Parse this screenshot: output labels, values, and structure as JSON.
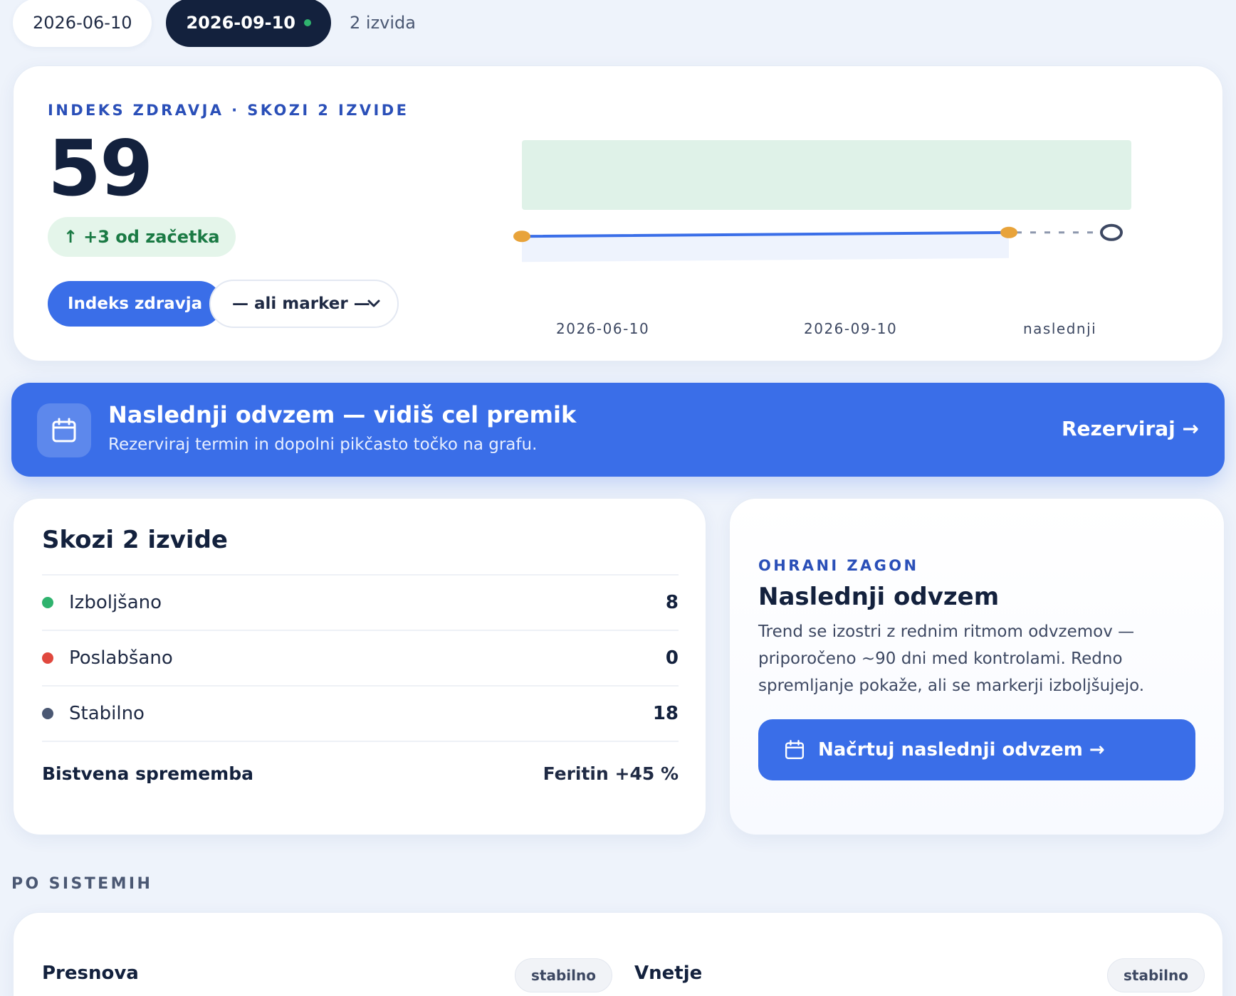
{
  "visits": {
    "tabs": [
      {
        "date": "2026-06-10",
        "active": false
      },
      {
        "date": "2026-09-10",
        "active": true
      }
    ],
    "count_label": "2 izvida"
  },
  "health_index": {
    "eyebrow": "INDEKS ZDRAVJA · SKOZI 2 IZVIDE",
    "score": "59",
    "delta_arrow": "↑",
    "delta_label": "+3 od začetka",
    "metric_button": "Indeks zdravja",
    "marker_select": {
      "selected": "— ali marker —"
    }
  },
  "chart_data": {
    "type": "line",
    "x": [
      "2026-06-10",
      "2026-09-10",
      "naslednji"
    ],
    "series": [
      {
        "values": [
          56,
          59,
          null
        ]
      }
    ],
    "projection": {
      "from": "2026-09-10",
      "to": "naslednji",
      "style": "dotted",
      "open_point": true
    },
    "target_band": true,
    "colors": {
      "line": "#3a6ee8",
      "point": "#e8a33a",
      "band": "#dcf1e6",
      "open_point": "#3d4862"
    }
  },
  "banner": {
    "title": "Naslednji odvzem — vidiš cel premik",
    "subtitle": "Rezerviraj termin in dopolni pikčasto točko na grafu.",
    "cta": "Rezerviraj →",
    "icon": "calendar-icon"
  },
  "summary": {
    "title": "Skozi 2 izvide",
    "rows": [
      {
        "label": "Izboljšano",
        "value": "8",
        "color": "#2fb36e"
      },
      {
        "label": "Poslabšano",
        "value": "0",
        "color": "#e0483e"
      },
      {
        "label": "Stabilno",
        "value": "18",
        "color": "#4b5873"
      }
    ],
    "footer": {
      "label": "Bistvena sprememba",
      "value": "Feritin +45 %"
    }
  },
  "momentum": {
    "eyebrow": "OHRANI ZAGON",
    "title": "Naslednji odvzem",
    "text": "Trend se izostri z rednim ritmom odvzemov — priporočeno ~90 dni med kontrolami. Redno spremljanje pokaže, ali se markerji izboljšujejo.",
    "button": "Načrtuj naslednji odvzem →"
  },
  "systems": {
    "section_label": "PO SISTEMIH",
    "items": [
      {
        "name": "Presnova",
        "status": "stabilno"
      },
      {
        "name": "Vnetje",
        "status": "stabilno"
      }
    ]
  },
  "colors": {
    "accent": "#3a6ee8",
    "dark": "#13213d",
    "background": "#eef3fb"
  }
}
